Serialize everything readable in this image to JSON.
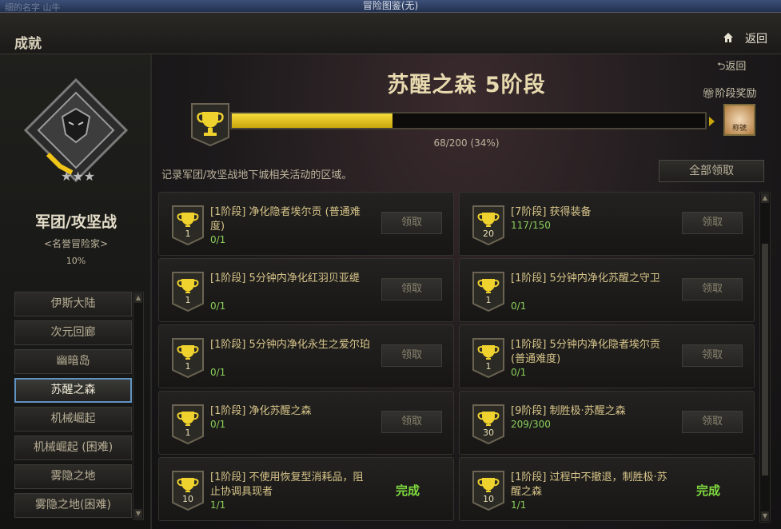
{
  "window": {
    "title": "冒险图鉴(无)",
    "bg_text": "细的名字 山牛"
  },
  "header": {
    "title": "成就",
    "back_label": "返回"
  },
  "left": {
    "category_title": "军团/攻坚战",
    "rank": "<名誉冒险家>",
    "percent": "10%",
    "nav_items": [
      "伊斯大陆",
      "次元回廊",
      "幽暗岛",
      "苏醒之森",
      "机械崛起",
      "机械崛起 (困难)",
      "雾隐之地",
      "雾隐之地(困难)"
    ],
    "active_index": 3
  },
  "main": {
    "stage_title": "苏醒之森 5阶段",
    "back_label": "返回",
    "reward_label": "阶段奖励",
    "progress_text": "68/200 (34%)",
    "progress_value": 0.34,
    "reward_icon_text": "称號",
    "description": "记录军团/攻坚战地下城相关活动的区域。",
    "claim_all_label": "全部领取",
    "claim_label": "领取",
    "done_label": "完成",
    "accent": "#f0d22e",
    "done_color": "#7fd93e"
  },
  "achievements": [
    {
      "name": "[1阶段] 净化隐者埃尔贡 (普通难度)",
      "progress": "0/1",
      "badge": "1",
      "status": "claim"
    },
    {
      "name": "[7阶段] 获得装备",
      "progress": "117/150",
      "badge": "20",
      "status": "claim"
    },
    {
      "name": "[1阶段] 5分钟内净化红羽贝亚缇",
      "progress": "0/1",
      "badge": "1",
      "status": "claim"
    },
    {
      "name": "[1阶段] 5分钟内净化苏醒之守卫",
      "progress": "0/1",
      "badge": "1",
      "status": "claim"
    },
    {
      "name": "[1阶段] 5分钟内净化永生之爱尔珀",
      "progress": "0/1",
      "badge": "1",
      "status": "claim"
    },
    {
      "name": "[1阶段] 5分钟内净化隐者埃尔贡 (普通难度)",
      "progress": "0/1",
      "badge": "1",
      "status": "claim"
    },
    {
      "name": "[1阶段] 净化苏醒之森",
      "progress": "0/1",
      "badge": "1",
      "status": "claim"
    },
    {
      "name": "[9阶段] 制胜极·苏醒之森",
      "progress": "209/300",
      "badge": "30",
      "status": "claim"
    },
    {
      "name": "[1阶段] 不使用恢复型消耗品，阻止协调具现者",
      "progress": "1/1",
      "badge": "10",
      "status": "done"
    },
    {
      "name": "[1阶段] 过程中不撤退，制胜极·苏醒之森",
      "progress": "1/1",
      "badge": "10",
      "status": "done"
    }
  ]
}
